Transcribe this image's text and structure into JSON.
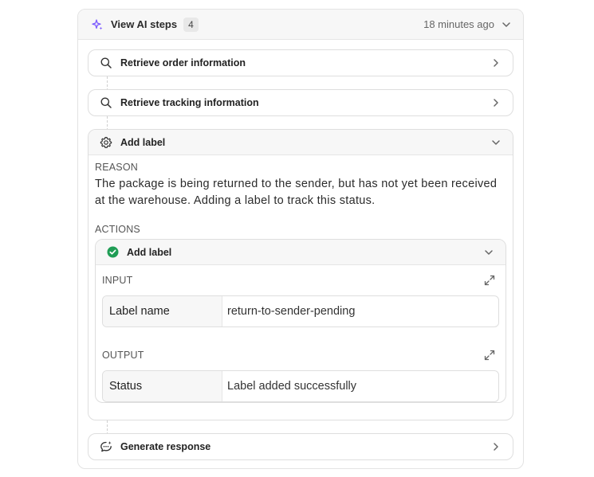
{
  "header": {
    "title": "View AI steps",
    "count": "4",
    "time": "18 minutes ago"
  },
  "steps": [
    {
      "label": "Retrieve order information",
      "icon": "search-icon"
    },
    {
      "label": "Retrieve tracking information",
      "icon": "search-icon"
    },
    {
      "label": "Add label",
      "icon": "gear-icon",
      "reason_title": "REASON",
      "reason_text": "The package is being returned to the sender, but has not yet been received at the warehouse. Adding a label to track this status.",
      "actions_title": "ACTIONS",
      "action": {
        "label": "Add label",
        "status": "success",
        "input_title": "INPUT",
        "input": {
          "key": "Label name",
          "value": "return-to-sender-pending"
        },
        "output_title": "OUTPUT",
        "output": {
          "key": "Status",
          "value": "Label added successfully"
        }
      }
    },
    {
      "label": "Generate response",
      "icon": "chat-sparkle-icon"
    }
  ],
  "colors": {
    "accent_purple": "#7c5cff",
    "success_green": "#1f9d55"
  }
}
